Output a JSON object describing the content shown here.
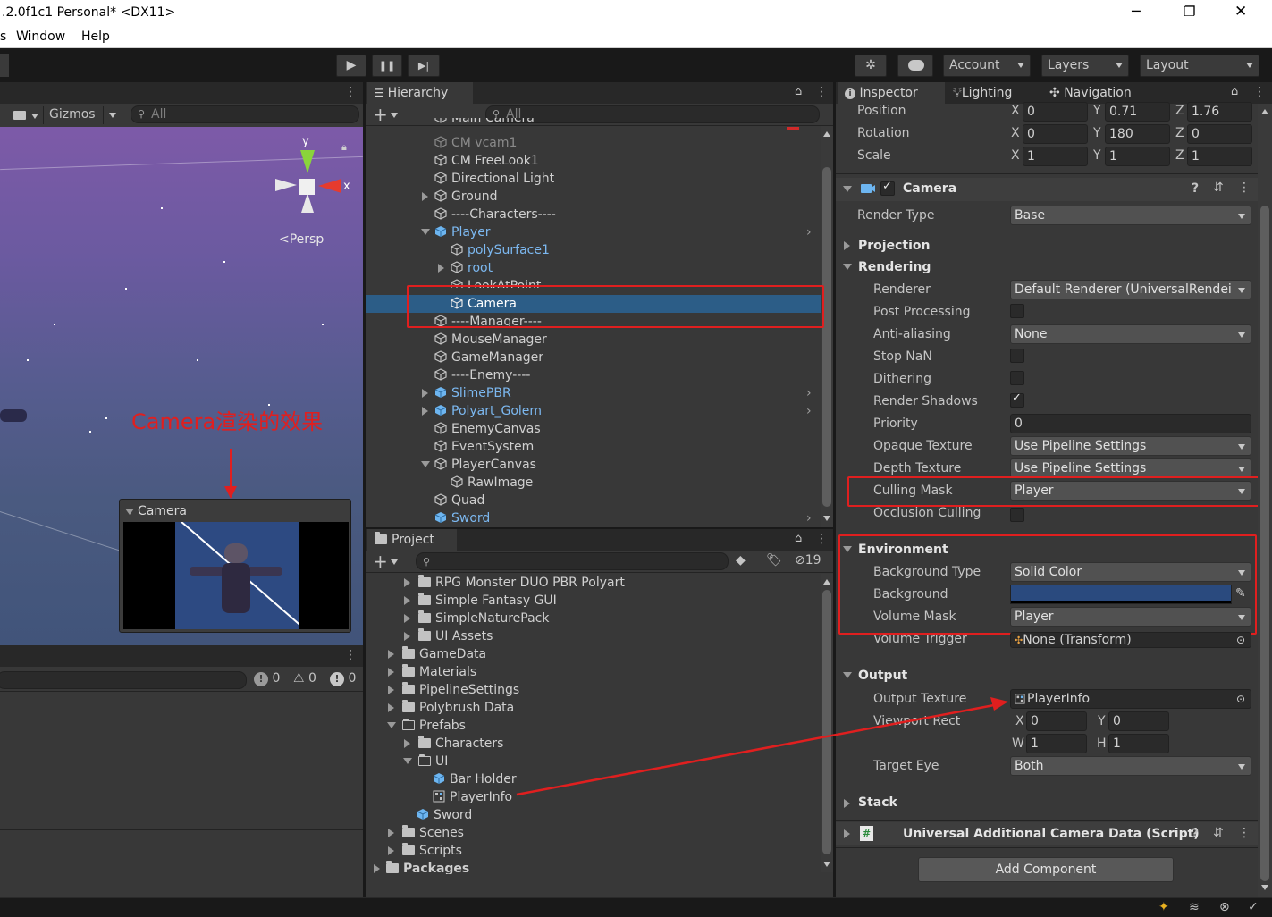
{
  "window": {
    "title": ".2.0f1c1 Personal* <DX11>",
    "controls": [
      "─",
      "❐",
      "✕"
    ]
  },
  "menu": {
    "items": [
      "s",
      "Window",
      "Help"
    ]
  },
  "toolbar": {
    "play": "▶",
    "pause": "❚❚",
    "step": "▶|",
    "account": "Account",
    "layers": "Layers",
    "layout": "Layout"
  },
  "scene": {
    "gizmos": "Gizmos",
    "search_placeholder": "All",
    "persp": "Persp",
    "axis_y": "y",
    "axis_x": "x",
    "annotation": "Camera渲染的效果",
    "preview_title": "Camera",
    "console_counts": [
      "0",
      "0",
      "0"
    ]
  },
  "hierarchy": {
    "tab": "Hierarchy",
    "search_placeholder": "All",
    "items": [
      {
        "label": "Main Camera",
        "style": "partial"
      },
      {
        "label": "CM vcam1",
        "style": "dim"
      },
      {
        "label": "CM FreeLook1",
        "style": "normal"
      },
      {
        "label": "Directional Light",
        "style": "normal"
      },
      {
        "label": "Ground",
        "style": "normal"
      },
      {
        "label": "----Characters----",
        "style": "normal"
      },
      {
        "label": "Player",
        "style": "blue"
      },
      {
        "label": "polySurface1",
        "style": "blue"
      },
      {
        "label": "root",
        "style": "blue"
      },
      {
        "label": "LookAtPoint",
        "style": "normal"
      },
      {
        "label": "Camera",
        "style": "selected"
      },
      {
        "label": "----Manager----",
        "style": "normal"
      },
      {
        "label": "MouseManager",
        "style": "normal"
      },
      {
        "label": "GameManager",
        "style": "normal"
      },
      {
        "label": "----Enemy----",
        "style": "normal"
      },
      {
        "label": "SlimePBR",
        "style": "blue"
      },
      {
        "label": "Polyart_Golem",
        "style": "blue"
      },
      {
        "label": "EnemyCanvas",
        "style": "normal"
      },
      {
        "label": "EventSystem",
        "style": "normal"
      },
      {
        "label": "PlayerCanvas",
        "style": "normal"
      },
      {
        "label": "RawImage",
        "style": "normal"
      },
      {
        "label": "Quad",
        "style": "normal"
      },
      {
        "label": "Sword",
        "style": "blue"
      }
    ]
  },
  "project": {
    "tab": "Project",
    "count": "19",
    "items": [
      {
        "label": "RPG Monster DUO PBR Polyart"
      },
      {
        "label": "Simple Fantasy GUI"
      },
      {
        "label": "SimpleNaturePack"
      },
      {
        "label": "UI Assets"
      },
      {
        "label": "GameData"
      },
      {
        "label": "Materials"
      },
      {
        "label": "PipelineSettings"
      },
      {
        "label": "Polybrush Data"
      },
      {
        "label": "Prefabs"
      },
      {
        "label": "Characters"
      },
      {
        "label": "UI"
      },
      {
        "label": "Bar Holder"
      },
      {
        "label": "PlayerInfo"
      },
      {
        "label": "Sword"
      },
      {
        "label": "Scenes"
      },
      {
        "label": "Scripts"
      },
      {
        "label": "Packages"
      }
    ]
  },
  "inspector": {
    "tabs": [
      "Inspector",
      "Lighting",
      "Navigation"
    ],
    "transform": {
      "position": {
        "label": "Position",
        "x": "0",
        "y": "0.71",
        "z": "1.76"
      },
      "rotation": {
        "label": "Rotation",
        "x": "0",
        "y": "180",
        "z": "0"
      },
      "scale": {
        "label": "Scale",
        "x": "1",
        "y": "1",
        "z": "1"
      },
      "axis": {
        "x": "X",
        "y": "Y",
        "z": "Z"
      }
    },
    "camera_title": "Camera",
    "render_type": {
      "label": "Render Type",
      "value": "Base"
    },
    "projection": "Projection",
    "rendering": "Rendering",
    "renderer": {
      "label": "Renderer",
      "value": "Default Renderer (UniversalRendei"
    },
    "post_processing": "Post Processing",
    "anti_aliasing": {
      "label": "Anti-aliasing",
      "value": "None"
    },
    "stop_nan": "Stop NaN",
    "dithering": "Dithering",
    "render_shadows": "Render Shadows",
    "priority": {
      "label": "Priority",
      "value": "0"
    },
    "opaque_texture": {
      "label": "Opaque Texture",
      "value": "Use Pipeline Settings"
    },
    "depth_texture": {
      "label": "Depth Texture",
      "value": "Use Pipeline Settings"
    },
    "culling_mask": {
      "label": "Culling Mask",
      "value": "Player"
    },
    "occlusion_culling": "Occlusion Culling",
    "environment": "Environment",
    "background_type": {
      "label": "Background Type",
      "value": "Solid Color"
    },
    "background": {
      "label": "Background",
      "color": "#2a4a7e"
    },
    "volume_mask": {
      "label": "Volume Mask",
      "value": "Player"
    },
    "volume_trigger": {
      "label": "Volume Trigger",
      "value": "None (Transform)"
    },
    "output": "Output",
    "output_texture": {
      "label": "Output Texture",
      "value": "PlayerInfo"
    },
    "viewport_rect": {
      "label": "Viewport Rect",
      "x": "0",
      "y": "0",
      "w": "1",
      "h": "1",
      "lx": "X",
      "ly": "Y",
      "lw": "W",
      "lh": "H"
    },
    "target_eye": {
      "label": "Target Eye",
      "value": "Both"
    },
    "stack": "Stack",
    "additional": "Universal Additional Camera Data (Script)",
    "add_component": "Add Component"
  },
  "colors": {
    "accent_red": "#e01f1f",
    "selection": "#2c5d87",
    "blue_text": "#7cb8f0"
  }
}
